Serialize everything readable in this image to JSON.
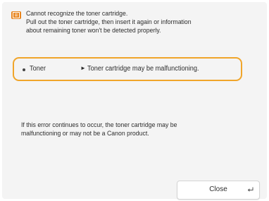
{
  "dialog": {
    "icon": "warning-icon",
    "accent_color": "#e8841c",
    "highlight_color": "#f0a52a",
    "message_lines": [
      "Cannot recognize the toner cartridge.",
      "Pull out the toner cartridge, then insert it again or information",
      "about remaining toner won't be detected properly."
    ],
    "status_item": {
      "label": "Toner",
      "arrow": "►",
      "status": "Toner cartridge may be malfunctioning."
    },
    "note_lines": [
      "If this error continues to occur, the toner cartridge may be",
      "malfunctioning or may not be a Canon product."
    ],
    "close_button": {
      "label": "Close",
      "icon": "enter-return-icon"
    }
  }
}
